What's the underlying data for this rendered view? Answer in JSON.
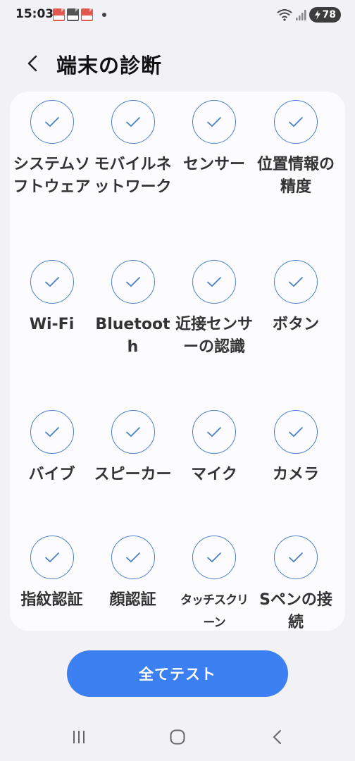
{
  "status_bar": {
    "time": "15:03",
    "notification_icons": [
      "pdf-icon",
      "pdf-icon",
      "pdf-icon"
    ],
    "battery_level": "78"
  },
  "header": {
    "title": "端末の診断"
  },
  "diagnostics": {
    "items": [
      {
        "label": "システムソフトウェア",
        "icon": "check-icon"
      },
      {
        "label": "モバイルネットワーク",
        "icon": "check-icon"
      },
      {
        "label": "センサー",
        "icon": "check-icon"
      },
      {
        "label": "位置情報の精度",
        "icon": "check-icon"
      },
      {
        "label": "Wi-Fi",
        "icon": "check-icon"
      },
      {
        "label": "Bluetooth",
        "icon": "check-icon"
      },
      {
        "label": "近接センサーの認識",
        "icon": "check-icon"
      },
      {
        "label": "ボタン",
        "icon": "check-icon"
      },
      {
        "label": "バイブ",
        "icon": "check-icon"
      },
      {
        "label": "スピーカー",
        "icon": "check-icon"
      },
      {
        "label": "マイク",
        "icon": "check-icon"
      },
      {
        "label": "カメラ",
        "icon": "check-icon"
      },
      {
        "label": "指紋認証",
        "icon": "check-icon"
      },
      {
        "label": "顔認証",
        "icon": "check-icon"
      },
      {
        "label": "タッチスクリーン",
        "icon": "check-icon"
      },
      {
        "label": "Sペンの接続",
        "icon": "check-icon"
      }
    ]
  },
  "actions": {
    "test_all_label": "全てテスト"
  },
  "colors": {
    "accent": "#3b7ff1",
    "check": "#4a7fc9",
    "background": "#f2f2f6",
    "card": "#fcfcfe"
  }
}
